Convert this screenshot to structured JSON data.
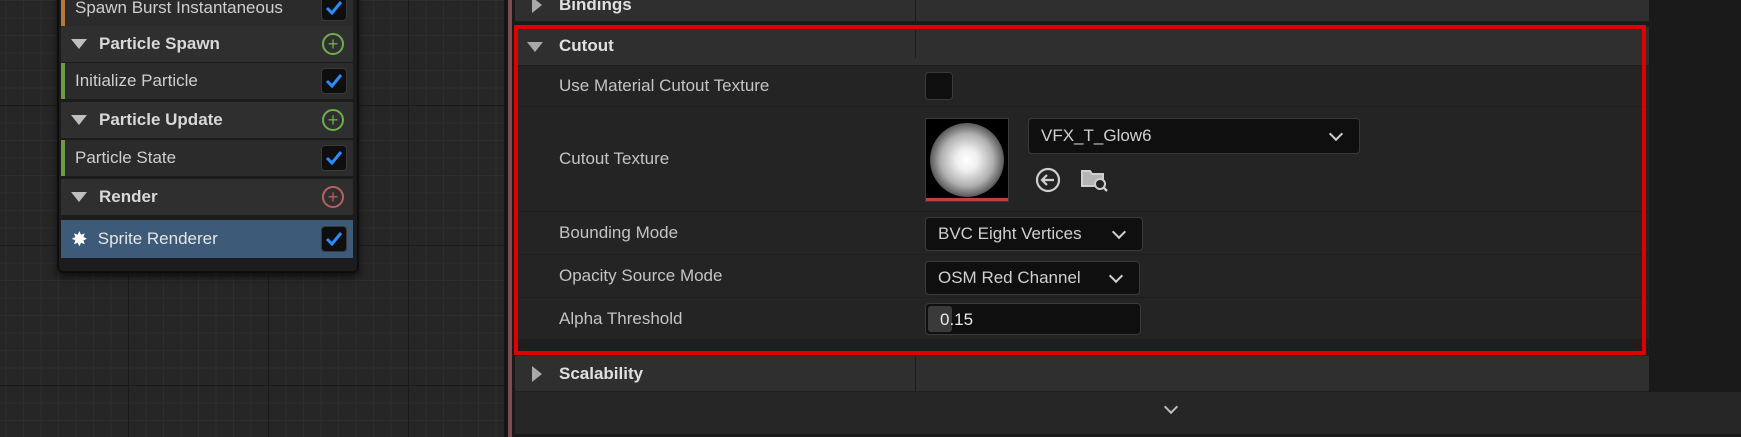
{
  "stack": {
    "top_module": {
      "label": "Spawn Burst Instantaneous",
      "checked": true
    },
    "particle_spawn": {
      "label": "Particle Spawn"
    },
    "initialize_particle": {
      "label": "Initialize Particle",
      "checked": true
    },
    "particle_update": {
      "label": "Particle Update"
    },
    "particle_state": {
      "label": "Particle State",
      "checked": true
    },
    "render": {
      "label": "Render"
    },
    "sprite_renderer": {
      "label": "Sprite Renderer",
      "checked": true
    }
  },
  "details": {
    "bindings": {
      "label": "Bindings"
    },
    "cutout": {
      "label": "Cutout",
      "use_material_cutout_texture": {
        "label": "Use Material Cutout Texture",
        "checked": false
      },
      "cutout_texture": {
        "label": "Cutout Texture",
        "asset": "VFX_T_Glow6"
      },
      "bounding_mode": {
        "label": "Bounding Mode",
        "value": "BVC Eight Vertices"
      },
      "opacity_source_mode": {
        "label": "Opacity Source Mode",
        "value": "OSM Red Channel"
      },
      "alpha_threshold": {
        "label": "Alpha Threshold",
        "value": "0.15"
      }
    },
    "scalability": {
      "label": "Scalability"
    }
  },
  "colors": {
    "highlight": "#e00000",
    "selected_row": "#3d5a78",
    "check_blue": "#2a8cff",
    "plus_green": "#6fae4c",
    "plus_red": "#b86060"
  }
}
